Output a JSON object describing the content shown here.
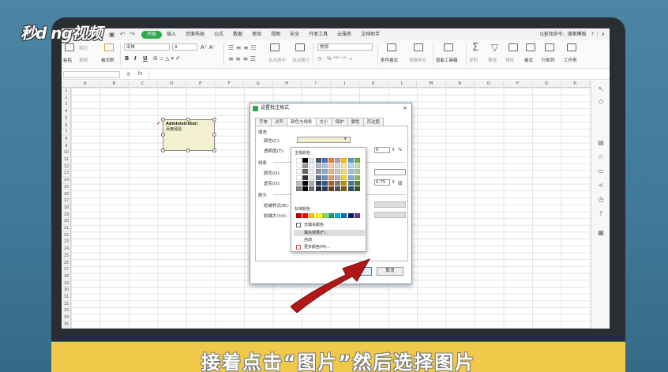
{
  "logo": {
    "text": "秒d ng视频"
  },
  "menubar": {
    "items": [
      "开始",
      "插入",
      "页面布局",
      "公式",
      "数据",
      "审阅",
      "视图",
      "安全",
      "开发工具",
      "云服务",
      "文档助手"
    ],
    "active": "开始",
    "search": "Q查找命令、搜索模板",
    "right_icons": "? ⋮ ∧"
  },
  "ribbon": {
    "paste": "粘贴",
    "cut": "剪切",
    "copy": "复制",
    "format_painter": "格式刷",
    "font_name": "宋体",
    "font_size": "9",
    "bold": "B",
    "italic": "I",
    "underline": "U",
    "merge": "合并居中",
    "wrap": "自动换行",
    "number_format": "常规",
    "conditional": "条件格式",
    "table_style": "表格样式",
    "smart_tools": "智能工具箱",
    "sum": "求和",
    "filter": "筛选",
    "sort": "排序",
    "format": "格式",
    "rows_cols": "行和列",
    "worksheet": "工作表"
  },
  "formula_bar": {
    "fx": "fx",
    "value": ""
  },
  "columns": [
    "A",
    "B",
    "C",
    "D",
    "E",
    "F",
    "G",
    "H",
    "I",
    "J",
    "K",
    "L",
    "M",
    "N",
    "O",
    "P",
    "Q",
    "R"
  ],
  "rows": [
    "1",
    "2",
    "3",
    "4",
    "5",
    "6",
    "7",
    "8",
    "9",
    "10",
    "11",
    "12",
    "13",
    "14",
    "15",
    "16",
    "17",
    "18",
    "19",
    "20",
    "21",
    "22",
    "23",
    "24",
    "25",
    "26",
    "27",
    "28",
    "29",
    "30",
    "31",
    "32",
    "33",
    "34",
    "35"
  ],
  "comment": {
    "author": "Administrator:",
    "text": "百度经验"
  },
  "dialog": {
    "title": "设置批注格式",
    "close": "×",
    "tabs": [
      "字体",
      "对齐",
      "颜色与线条",
      "大小",
      "保护",
      "属性",
      "页边距"
    ],
    "active_tab": "颜色与线条",
    "fill_section": "填充",
    "color_label": "颜色(C):",
    "transparency_label": "透明度(T):",
    "transparency_value": "0",
    "percent": "%",
    "line_section": "线条",
    "line_color_label": "颜色(O):",
    "dash_label": "虚实(D):",
    "weight_value": "0.75",
    "weight_unit": "磅",
    "arrow_section": "箭头",
    "begin_style_label": "始端样式(B):",
    "begin_size_label": "始端大小(I):",
    "ok": "确定",
    "cancel": "取消"
  },
  "color_popup": {
    "theme_label": "主题颜色",
    "standard_label": "标准颜色",
    "no_fill": "无填充颜色",
    "fill_effects": "填充效果(F)...",
    "auto": "自动",
    "more_colors": "更多颜色(M)..."
  },
  "colors": {
    "theme_top": [
      "#ffffff",
      "#000000",
      "#e7e6e6",
      "#44546a",
      "#4472c4",
      "#ed7d31",
      "#a5a5a5",
      "#ffc000",
      "#5b9bd5",
      "#70ad47"
    ],
    "standard": [
      "#c00000",
      "#ff0000",
      "#ffc000",
      "#ffff00",
      "#92d050",
      "#00b050",
      "#00b0f0",
      "#0070c0",
      "#002060",
      "#7030a0"
    ],
    "arrow": "#b01818",
    "caption_bg": "#f0c94a",
    "accent_green": "#2fa84f"
  },
  "caption": {
    "text": "接着点击“图片”然后选择图片"
  }
}
